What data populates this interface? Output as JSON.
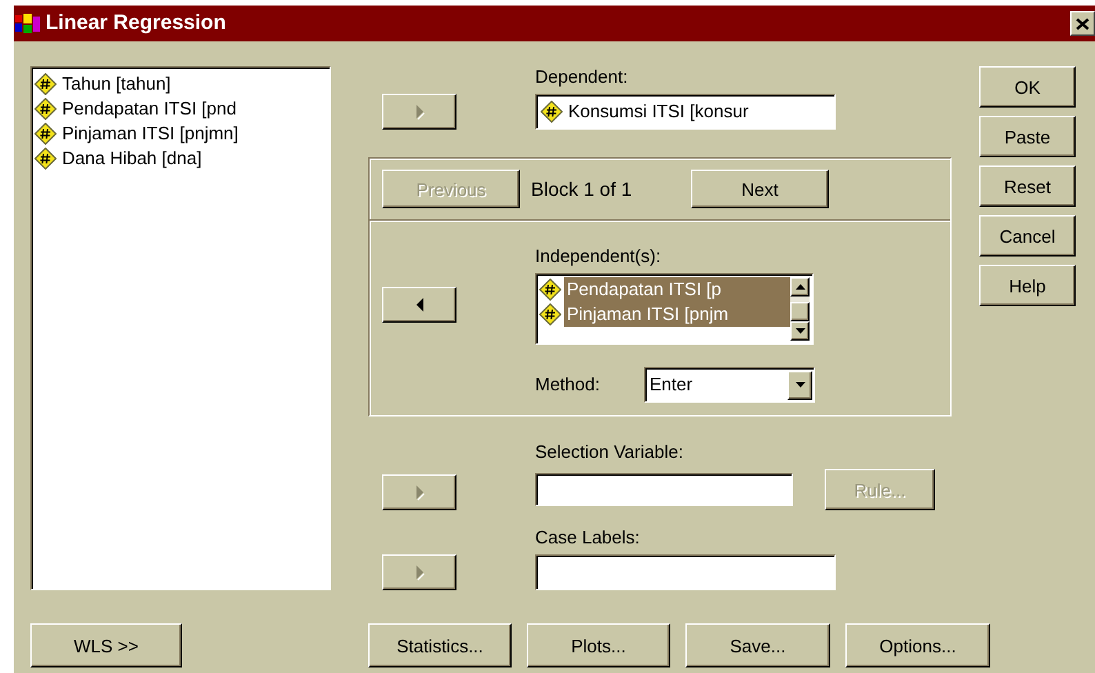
{
  "window": {
    "title": "Linear Regression"
  },
  "variables": [
    {
      "text": "Tahun [tahun]"
    },
    {
      "text": "Pendapatan ITSI [pnd"
    },
    {
      "text": "Pinjaman ITSI [pnjmn]"
    },
    {
      "text": "Dana Hibah [dna]"
    }
  ],
  "dependent": {
    "move_button": {
      "kind": "right",
      "disabled": true
    },
    "label": "Dependent:",
    "value": "Konsumsi ITSI [konsur"
  },
  "block": {
    "previous": {
      "label": "Previous",
      "disabled": true
    },
    "text": "Block 1 of 1",
    "next": {
      "label": "Next",
      "disabled": false
    }
  },
  "independents": {
    "move_button": {
      "kind": "left",
      "disabled": false
    },
    "label": "Independent(s):",
    "items": [
      {
        "text": "Pendapatan ITSI [p",
        "selected": true
      },
      {
        "text": "Pinjaman ITSI [pnjm",
        "selected": true
      }
    ]
  },
  "method": {
    "label": "Method:",
    "value": "Enter"
  },
  "selection": {
    "move_button": {
      "kind": "right",
      "disabled": true
    },
    "label": "Selection Variable:",
    "rule": {
      "label": "Rule...",
      "disabled": true
    }
  },
  "case_labels": {
    "move_button": {
      "kind": "right",
      "disabled": true
    },
    "label": "Case Labels:"
  },
  "side_buttons": [
    "OK",
    "Paste",
    "Reset",
    "Cancel",
    "Help"
  ],
  "bottom_buttons": [
    "WLS >>",
    "Statistics...",
    "Plots...",
    "Save...",
    "Options..."
  ]
}
